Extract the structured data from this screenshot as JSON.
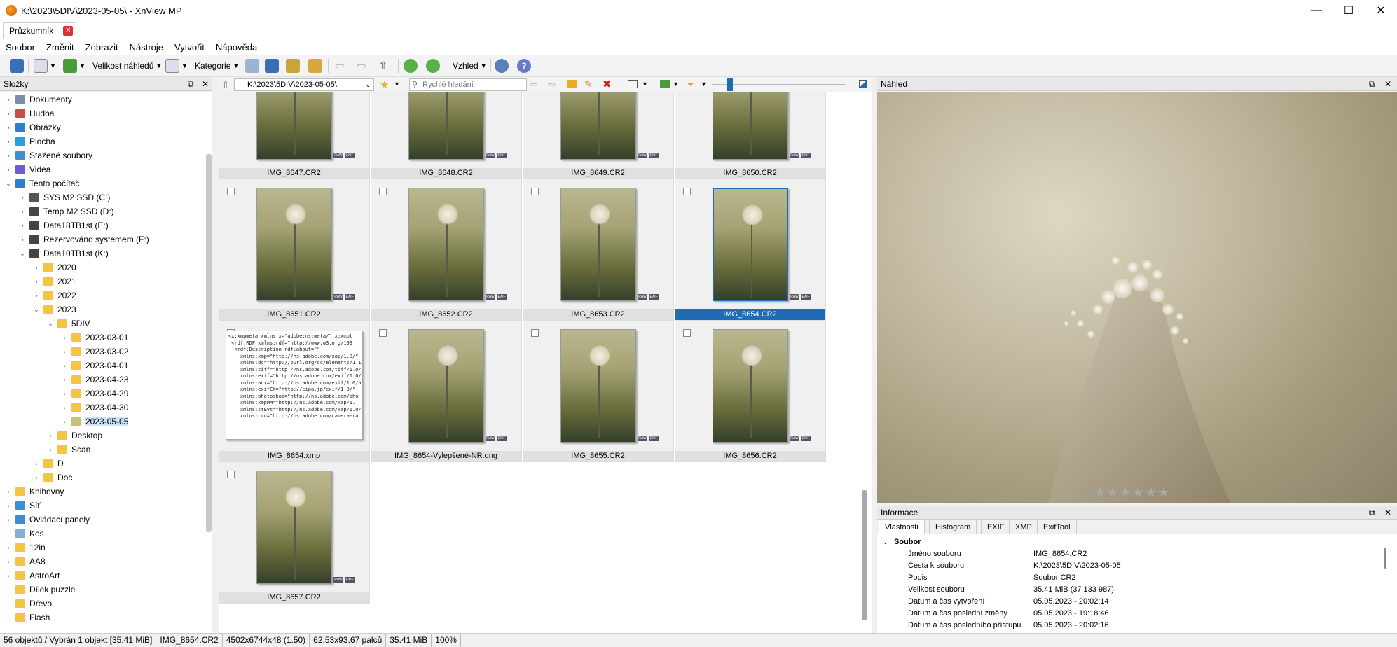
{
  "window": {
    "title": "K:\\2023\\5DIV\\2023-05-05\\ - XnView MP",
    "minimize": "—",
    "maximize": "☐",
    "close": "✕"
  },
  "tab": {
    "label": "Průzkumník",
    "close": "✕"
  },
  "menu": [
    "Soubor",
    "Změnit",
    "Zobrazit",
    "Nástroje",
    "Vytvořit",
    "Nápověda"
  ],
  "toolbar": {
    "thumb_size_label": "Velikost náhledů",
    "category_label": "Kategorie",
    "view_label": "Vzhled"
  },
  "folders_panel": {
    "title": "Složky",
    "pin": "⧉",
    "close": "✕"
  },
  "tree": [
    {
      "label": "Dokumenty",
      "indent": 0,
      "exp": "›",
      "icon": "#7a8ea8"
    },
    {
      "label": "Hudba",
      "indent": 0,
      "exp": "›",
      "icon": "#d24b4b"
    },
    {
      "label": "Obrázky",
      "indent": 0,
      "exp": "›",
      "icon": "#2d7fd1"
    },
    {
      "label": "Plocha",
      "indent": 0,
      "exp": "›",
      "icon": "#2d9fd8"
    },
    {
      "label": "Stažené soubory",
      "indent": 0,
      "exp": "›",
      "icon": "#3d8fd1"
    },
    {
      "label": "Videa",
      "indent": 0,
      "exp": "›",
      "icon": "#6b5fd1"
    },
    {
      "label": "Tento počítač",
      "indent": 0,
      "exp": "⌄",
      "icon": "#2d7fd1"
    },
    {
      "label": "SYS M2 SSD (C:)",
      "indent": 1,
      "exp": "›",
      "icon": "#555"
    },
    {
      "label": "Temp M2 SSD (D:)",
      "indent": 1,
      "exp": "›",
      "icon": "#444"
    },
    {
      "label": "Data18TB1st (E:)",
      "indent": 1,
      "exp": "›",
      "icon": "#444"
    },
    {
      "label": "Rezervováno systémem (F:)",
      "indent": 1,
      "exp": "›",
      "icon": "#444"
    },
    {
      "label": "Data10TB1st (K:)",
      "indent": 1,
      "exp": "⌄",
      "icon": "#444"
    },
    {
      "label": "2020",
      "indent": 2,
      "exp": "›",
      "icon": "#f4c542"
    },
    {
      "label": "2021",
      "indent": 2,
      "exp": "›",
      "icon": "#f4c542"
    },
    {
      "label": "2022",
      "indent": 2,
      "exp": "›",
      "icon": "#f4c542"
    },
    {
      "label": "2023",
      "indent": 2,
      "exp": "⌄",
      "icon": "#f4c542"
    },
    {
      "label": "5DIV",
      "indent": 3,
      "exp": "⌄",
      "icon": "#f4c542"
    },
    {
      "label": "2023-03-01",
      "indent": 4,
      "exp": "›",
      "icon": "#f4c542"
    },
    {
      "label": "2023-03-02",
      "indent": 4,
      "exp": "›",
      "icon": "#f4c542"
    },
    {
      "label": "2023-04-01",
      "indent": 4,
      "exp": "›",
      "icon": "#f4c542"
    },
    {
      "label": "2023-04-23",
      "indent": 4,
      "exp": "›",
      "icon": "#f4c542"
    },
    {
      "label": "2023-04-29",
      "indent": 4,
      "exp": "›",
      "icon": "#f4c542"
    },
    {
      "label": "2023-04-30",
      "indent": 4,
      "exp": "›",
      "icon": "#f4c542"
    },
    {
      "label": "2023-05-05",
      "indent": 4,
      "exp": "›",
      "icon": "#c9c07a",
      "selected": true
    },
    {
      "label": "Desktop",
      "indent": 3,
      "exp": "›",
      "icon": "#f4c542"
    },
    {
      "label": "Scan",
      "indent": 3,
      "exp": "›",
      "icon": "#f4c542"
    },
    {
      "label": "D",
      "indent": 2,
      "exp": "›",
      "icon": "#f4c542"
    },
    {
      "label": "Doc",
      "indent": 2,
      "exp": "›",
      "icon": "#f4c542"
    },
    {
      "label": "Knihovny",
      "indent": 0,
      "exp": "›",
      "icon": "#f4c542"
    },
    {
      "label": "Síť",
      "indent": 0,
      "exp": "›",
      "icon": "#3d8fd1"
    },
    {
      "label": "Ovládací panely",
      "indent": 0,
      "exp": "›",
      "icon": "#3d8fd1"
    },
    {
      "label": "Koš",
      "indent": 0,
      "exp": "",
      "icon": "#7fb0d8"
    },
    {
      "label": "12in",
      "indent": 0,
      "exp": "›",
      "icon": "#f4c542"
    },
    {
      "label": "AA8",
      "indent": 0,
      "exp": "›",
      "icon": "#f4c542"
    },
    {
      "label": "AstroArt",
      "indent": 0,
      "exp": "›",
      "icon": "#f4c542"
    },
    {
      "label": "Dílek puzzle",
      "indent": 0,
      "exp": "",
      "icon": "#f4c542"
    },
    {
      "label": "Dřevo",
      "indent": 0,
      "exp": "",
      "icon": "#f4c542"
    },
    {
      "label": "Flash",
      "indent": 0,
      "exp": "",
      "icon": "#f4c542"
    }
  ],
  "pathbar": {
    "path": "K:\\2023\\5DIV\\2023-05-05\\",
    "search_placeholder": "Rychlé hledání"
  },
  "files": [
    {
      "name": "IMG_8647.CR2",
      "type": "img"
    },
    {
      "name": "IMG_8648.CR2",
      "type": "img"
    },
    {
      "name": "IMG_8649.CR2",
      "type": "img"
    },
    {
      "name": "IMG_8650.CR2",
      "type": "img"
    },
    {
      "name": "IMG_8651.CR2",
      "type": "img"
    },
    {
      "name": "IMG_8652.CR2",
      "type": "img"
    },
    {
      "name": "IMG_8653.CR2",
      "type": "img"
    },
    {
      "name": "IMG_8654.CR2",
      "type": "img",
      "selected": true
    },
    {
      "name": "IMG_8654.xmp",
      "type": "xmp"
    },
    {
      "name": "IMG_8654-Vylepšené-NR.dng",
      "type": "img"
    },
    {
      "name": "IMG_8655.CR2",
      "type": "img"
    },
    {
      "name": "IMG_8656.CR2",
      "type": "img"
    },
    {
      "name": "IMG_8657.CR2",
      "type": "img"
    }
  ],
  "badges": [
    "RAW",
    "EXIF"
  ],
  "xmp_text": "<x:xmpmeta xmlns:x=\"adobe:ns:meta/\" x:xmpt\n <rdf:RDF xmlns:rdf=\"http://www.w3.org/199\n  <rdf:Description rdf:about=\"\"\n    xmlns:xmp=\"http://ns.adobe.com/xap/1.0/\"\n    xmlns:dc=\"http://purl.org/dc/elements/1.1/\"\n    xmlns:tiff=\"http://ns.adobe.com/tiff/1.0/\"\n    xmlns:exif=\"http://ns.adobe.com/exif/1.0/\"\n    xmlns:aux=\"http://ns.adobe.com/exif/1.0/au\n    xmlns:exifEX=\"http://cipa.jp/exif/1.0/\"\n    xmlns:photoshop=\"http://ns.adobe.com/pho\n    xmlns:xmpMM=\"http://ns.adobe.com/xap/1.\n    xmlns:stEvt=\"http://ns.adobe.com/xap/1.0/s\n    xmlns:crd=\"http://ns.adobe.com/camera-ra",
  "preview_panel": {
    "title": "Náhled",
    "pin": "⧉",
    "close": "✕",
    "rating": 0
  },
  "info_panel": {
    "title": "Informace",
    "pin": "⧉",
    "close": "✕",
    "tabs": [
      "Vlastnosti",
      "Histogram",
      "EXIF",
      "XMP",
      "ExifTool"
    ],
    "section": "Soubor",
    "rows": [
      {
        "k": "Jméno souboru",
        "v": "IMG_8654.CR2"
      },
      {
        "k": "Cesta k souboru",
        "v": "K:\\2023\\5DIV\\2023-05-05"
      },
      {
        "k": "Popis",
        "v": "Soubor CR2"
      },
      {
        "k": "Velikost souboru",
        "v": "35.41 MiB (37 133 987)"
      },
      {
        "k": "Datum a čas vytvoření",
        "v": "05.05.2023 - 20:02:14"
      },
      {
        "k": "Datum a čas poslední změny",
        "v": "05.05.2023 - 19:18:46"
      },
      {
        "k": "Datum a čas posledního přístupu",
        "v": "05.05.2023 - 20:02:16"
      }
    ]
  },
  "status": [
    "56 objektů / Vybrán 1 objekt [35.41 MiB]",
    "IMG_8654.CR2",
    "4502x6744x48 (1.50)",
    "62.53x93.67 palců",
    "35.41 MiB",
    "100%"
  ]
}
